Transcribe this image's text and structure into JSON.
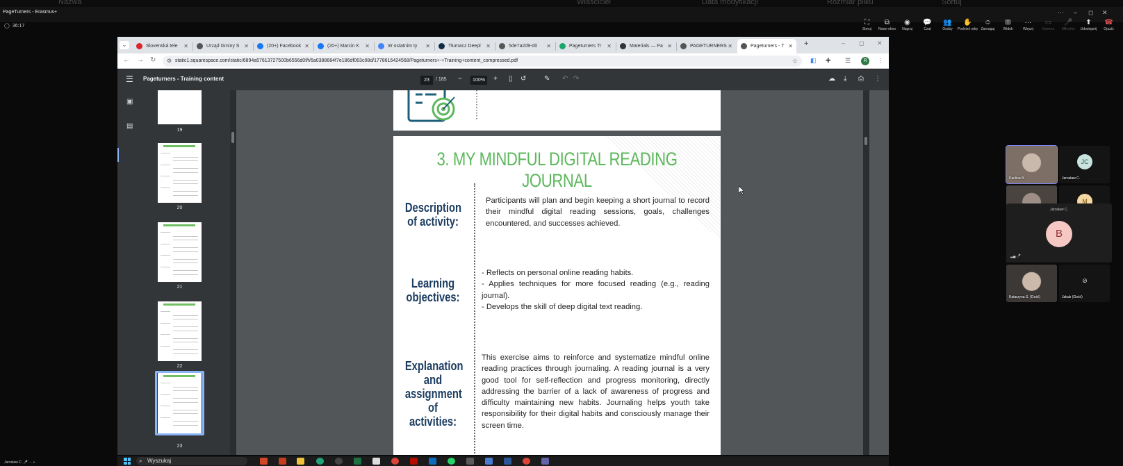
{
  "teams": {
    "top_strip": [
      "Nazwa",
      "Właściciel",
      "Data modyfikacji",
      "Rozmiar pliku",
      "Sortuj"
    ],
    "app_title": "PageTurners - Erasmus+",
    "timer": "36:17",
    "toolbar": [
      {
        "label": "Steruj",
        "icon": "control-icon"
      },
      {
        "label": "Nowe okno",
        "icon": "new-window-icon"
      },
      {
        "label": "Nagraj",
        "icon": "record-icon"
      },
      {
        "label": "Czat",
        "icon": "chat-icon"
      },
      {
        "label": "Osoby",
        "icon": "people-icon"
      },
      {
        "label": "Podnieś rękę",
        "icon": "raise-hand-icon"
      },
      {
        "label": "Zareaguj",
        "icon": "react-icon"
      },
      {
        "label": "Widok",
        "icon": "view-icon"
      },
      {
        "label": "Więcej",
        "icon": "more-icon"
      },
      {
        "label": "Kamera",
        "icon": "camera-icon"
      },
      {
        "label": "Mikrofon",
        "icon": "mic-icon"
      },
      {
        "label": "Udostępnij",
        "icon": "share-icon"
      },
      {
        "label": "Opuść",
        "icon": "leave-icon"
      }
    ],
    "participants": [
      {
        "name": "Paulina B.",
        "type": "video",
        "active": true
      },
      {
        "name": "Jarosław C.",
        "type": "avatar",
        "initials": "JC",
        "avatar_bg": "#c9e4de",
        "avatar_fg": "#2e5a52"
      },
      {
        "name": "Bartek (Gość)",
        "type": "video"
      },
      {
        "name": "Magdalena (Gość)",
        "type": "avatar",
        "initials": "M",
        "avatar_bg": "#f4d7a1",
        "avatar_fg": "#7a5413"
      },
      {
        "name": "Anna P. (Gość)",
        "type": "video"
      },
      {
        "name": "Monika (Gość)",
        "type": "video"
      },
      {
        "name": "Katarzyna S. (Gość)",
        "type": "video"
      },
      {
        "name": "Jakub (Gość)",
        "type": "camera-off"
      }
    ],
    "presenter": {
      "name": "Jarosław C.",
      "initial": "B"
    },
    "self_label": "Jarosław C."
  },
  "browser": {
    "tabs": [
      {
        "title": "Slovenská tele",
        "color": "#d9262b"
      },
      {
        "title": "Urząd Gminy S",
        "color": "#555555"
      },
      {
        "title": "(20+) Facebook",
        "color": "#1877f2"
      },
      {
        "title": "(20+) Marcin K",
        "color": "#1877f2"
      },
      {
        "title": "W ostatnim ty",
        "color": "#4285f4"
      },
      {
        "title": "Tłumacz Deepl",
        "color": "#0f2b46"
      },
      {
        "title": "5de7a2d9-d0",
        "color": "#555555"
      },
      {
        "title": "Pageturners Tr",
        "color": "#18a66a"
      },
      {
        "title": "Materials — Pa",
        "color": "#333333"
      },
      {
        "title": "PAGETURNERS",
        "color": "#555555"
      },
      {
        "title": "Pageturners - T",
        "color": "#555555",
        "active": true
      }
    ],
    "url": "static1.squarespace.com/static/6894a57613727500b6556d0f/t/6a0388684f7e186df063c08d/1778616424568/Pageturners+-+Training+content_compressed.pdf",
    "profile_initial": "R"
  },
  "pdf": {
    "title": "Pageturners - Training content",
    "current_page": "23",
    "total_pages": "/ 185",
    "zoom": "100%",
    "thumbnails": [
      "19",
      "20",
      "21",
      "22",
      "23"
    ],
    "page": {
      "heading": "3. MY MINDFUL DIGITAL READING JOURNAL",
      "sections": [
        {
          "label": "Description of activity:",
          "text": "Participants will plan and begin keeping a short journal to record their mindful digital reading sessions, goals, challenges encountered, and successes achieved."
        },
        {
          "label": "Learning objectives:",
          "text": "- Reflects on personal online reading habits.\n- Applies techniques for more focused reading (e.g., reading journal).\n- Develops the skill of deep digital text reading."
        },
        {
          "label": "Explanation and assignment of activities:",
          "text": "This exercise aims to reinforce and systematize mindful online reading practices through journaling. A reading journal is a very good tool for self-reflection and progress monitoring, directly addressing the barrier of a lack of awareness of progress and difficulty maintaining new habits. Journaling helps youth take responsibility for their digital habits and consciously manage their screen time."
        }
      ]
    }
  },
  "taskbar": {
    "search_placeholder": "Wyszukaj"
  }
}
